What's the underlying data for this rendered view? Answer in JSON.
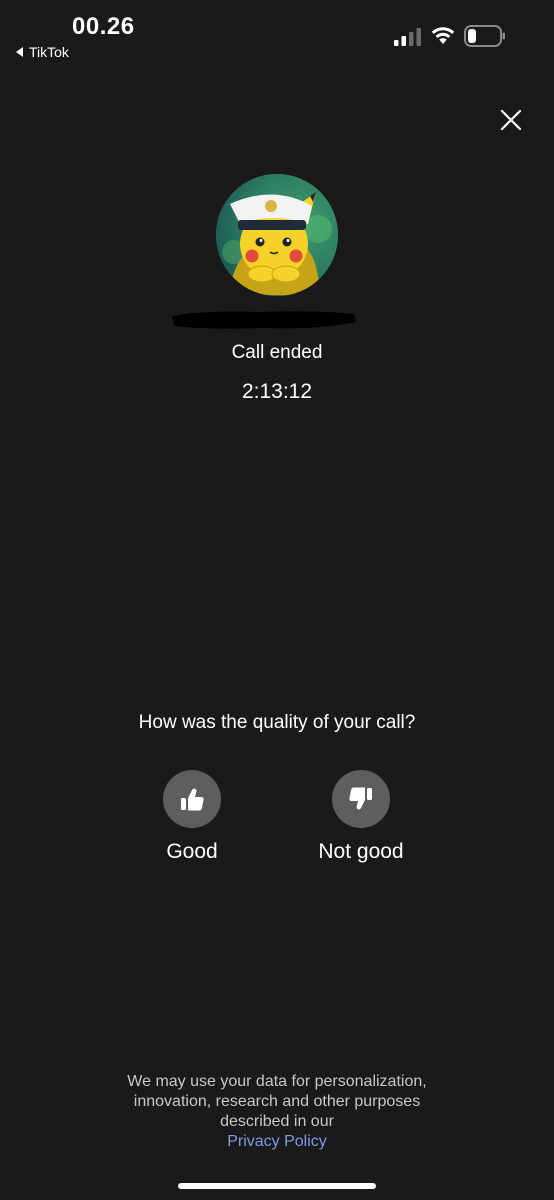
{
  "status_bar": {
    "time": "00.26",
    "back_app": "TikTok"
  },
  "call": {
    "status": "Call ended",
    "duration": "2:13:12"
  },
  "feedback": {
    "question": "How was the quality of your call?",
    "good_label": "Good",
    "bad_label": "Not good"
  },
  "footer": {
    "text": "We may use your data for personalization, innovation, research and other purposes described in our",
    "link": "Privacy Policy"
  },
  "icons": {
    "close": "close-icon",
    "good": "thumbs-up-icon",
    "bad": "thumbs-down-icon",
    "signal": "cellular-signal-icon",
    "wifi": "wifi-icon",
    "battery": "battery-icon"
  },
  "colors": {
    "background": "#1a1a1a",
    "button_circle": "#5e5e5e",
    "link": "#7f9be8"
  }
}
